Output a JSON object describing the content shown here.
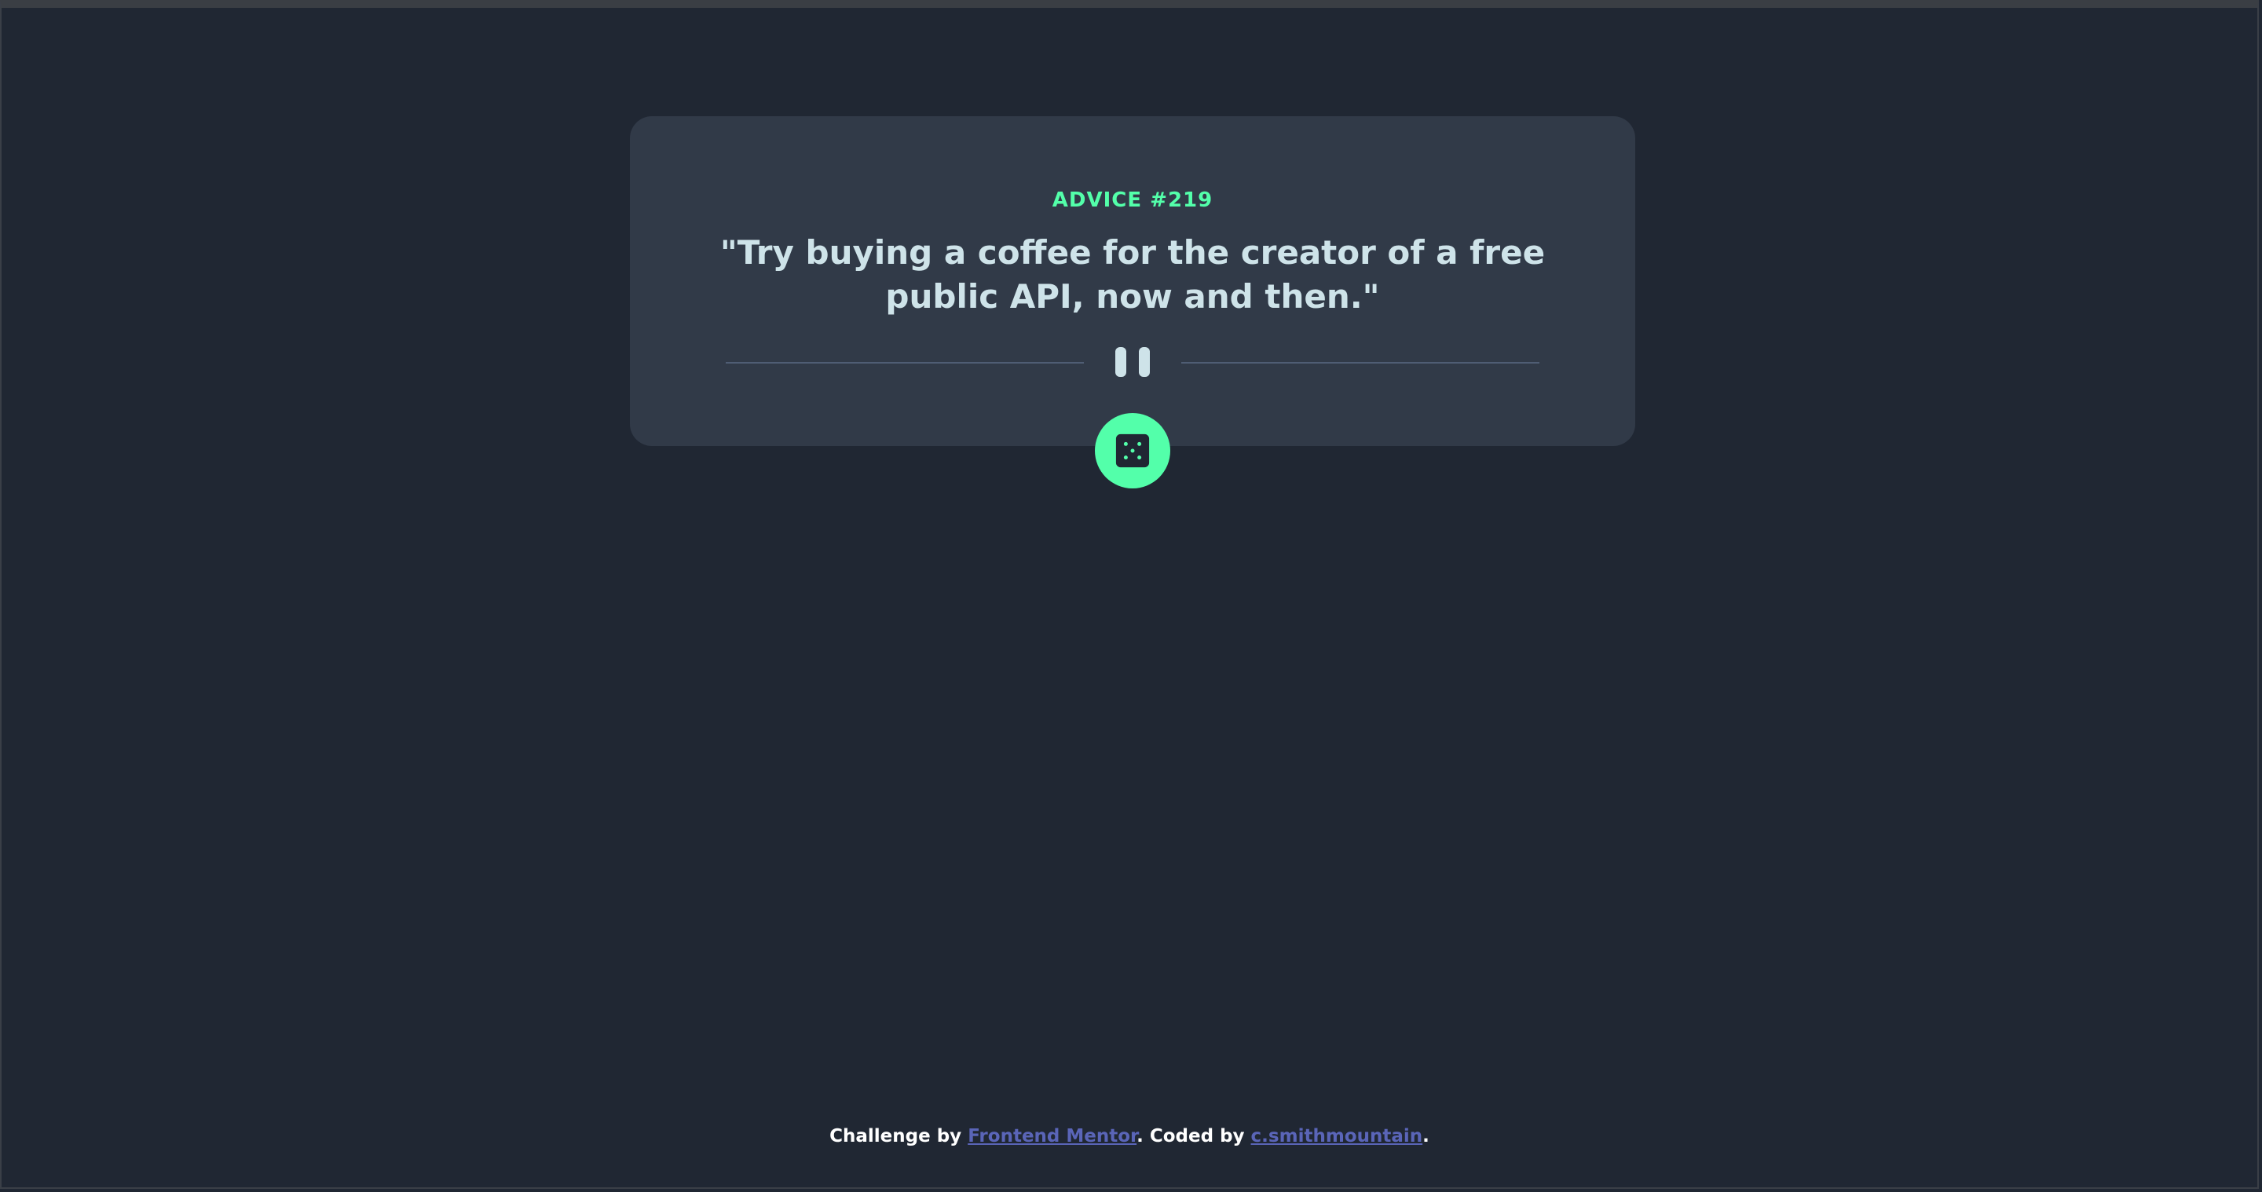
{
  "card": {
    "advice_id": "ADVICE #219",
    "advice_text": "\"Try buying a coffee for the creator of a free public API, now and then.\""
  },
  "icons": {
    "divider": "pause-icon",
    "dice": "dice-icon"
  },
  "footer": {
    "challenge_prefix": "Challenge by ",
    "challenge_link": "Frontend Mentor",
    "coded_prefix": ". Coded by ",
    "coded_link": "c.smithmountain",
    "suffix": "."
  },
  "colors": {
    "background": "#202733",
    "card": "#313a48",
    "accent": "#53ffaa",
    "text": "#cee3e9",
    "link": "#5a65b8"
  }
}
